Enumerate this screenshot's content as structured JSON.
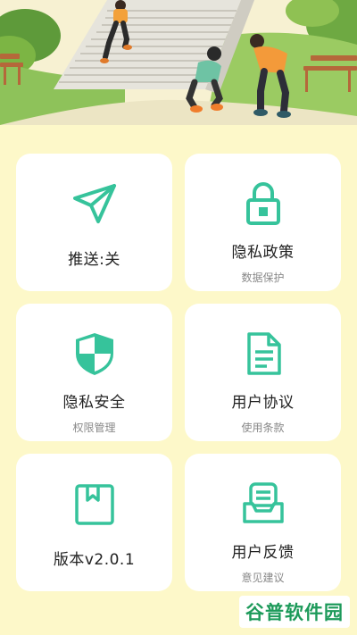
{
  "colors": {
    "accent": "#36c39b",
    "background": "#fdf8c9",
    "card": "#ffffff"
  },
  "cards": [
    {
      "icon": "send-icon",
      "title": "推送:关",
      "subtitle": ""
    },
    {
      "icon": "lock-icon",
      "title": "隐私政策",
      "subtitle": "数据保护"
    },
    {
      "icon": "shield-icon",
      "title": "隐私安全",
      "subtitle": "权限管理"
    },
    {
      "icon": "document-icon",
      "title": "用户协议",
      "subtitle": "使用条款"
    },
    {
      "icon": "bookmark-icon",
      "title": "版本v2.0.1",
      "subtitle": ""
    },
    {
      "icon": "feedback-icon",
      "title": "用户反馈",
      "subtitle": "意见建议"
    }
  ],
  "watermark": {
    "text": "谷普软件园"
  }
}
